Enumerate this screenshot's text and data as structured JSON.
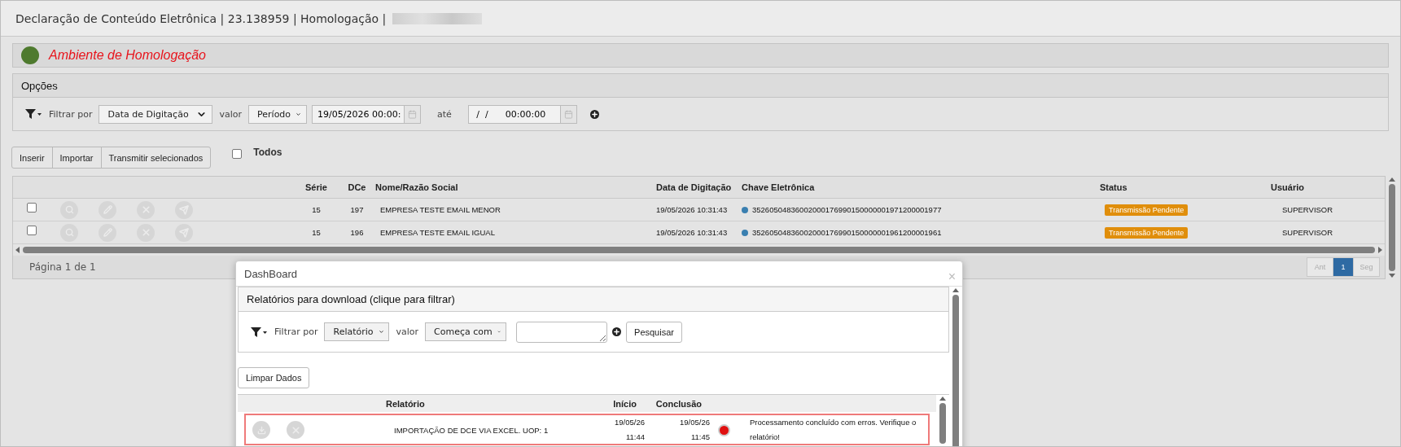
{
  "window": {
    "title": "Declaração de Conteúdo Eletrônica | 23.138959 | Homologação |"
  },
  "environment": {
    "label": "Ambiente de Homologação",
    "color": "#4e7a2e"
  },
  "options": {
    "title": "Opções",
    "filter_label": "Filtrar por",
    "filter_field": "Data de Digitação",
    "value_label": "valor",
    "value_mode": "Período",
    "date_from": "19/05/2026 00:00:",
    "until_label": "até",
    "date_to": " /  /      00:00:00"
  },
  "toolbar": {
    "buttons": [
      "Inserir",
      "Importar",
      "Transmitir selecionados"
    ],
    "select_all": {
      "label": "Todos",
      "checked": false
    }
  },
  "table": {
    "columns": [
      "Série",
      "DCe",
      "Nome/Razão Social",
      "Data de Digitação",
      "Chave Eletrônica",
      "Status",
      "Usuário"
    ],
    "rows": [
      {
        "checked": false,
        "serie": "15",
        "dce": "197",
        "nome": "EMPRESA TESTE EMAIL MENOR",
        "data": "19/05/2026 10:31:43",
        "chave": "35260504836002000176990150000001971200001977",
        "status": "Transmissão Pendente",
        "usuario": "SUPERVISOR"
      },
      {
        "checked": false,
        "serie": "15",
        "dce": "196",
        "nome": "EMPRESA TESTE EMAIL IGUAL",
        "data": "19/05/2026 10:31:43",
        "chave": "35260504836002000176990150000001961200001961",
        "status": "Transmissão Pendente",
        "usuario": "SUPERVISOR"
      }
    ]
  },
  "pager": {
    "label": "Página 1 de 1",
    "buttons": [
      {
        "label": "Ant",
        "selected": false,
        "disabled": true
      },
      {
        "label": "1",
        "selected": true,
        "disabled": false
      },
      {
        "label": "Seg",
        "selected": false,
        "disabled": true
      }
    ]
  },
  "dialog": {
    "title": "DashBoard",
    "close": "×",
    "section_title": "Relatórios para download (clique para filtrar)",
    "filter": {
      "filter_label": "Filtrar por",
      "filter_field": "Relatório",
      "value_label": "valor",
      "value_mode": "Começa com",
      "search_button": "Pesquisar"
    },
    "clear_button": "Limpar Dados",
    "columns": [
      "Relatório",
      "Início",
      "Conclusão"
    ],
    "rows": [
      {
        "selected": true,
        "relatorio": "IMPORTAÇÃO DE DCE VIA EXCEL. UOP: 1",
        "inicio_date": "19/05/26",
        "inicio_time": "11:44",
        "conclusao_date": "19/05/26",
        "conclusao_time": "11:45",
        "message": "Processamento concluído com erros. Verifique o relatório!"
      }
    ]
  }
}
